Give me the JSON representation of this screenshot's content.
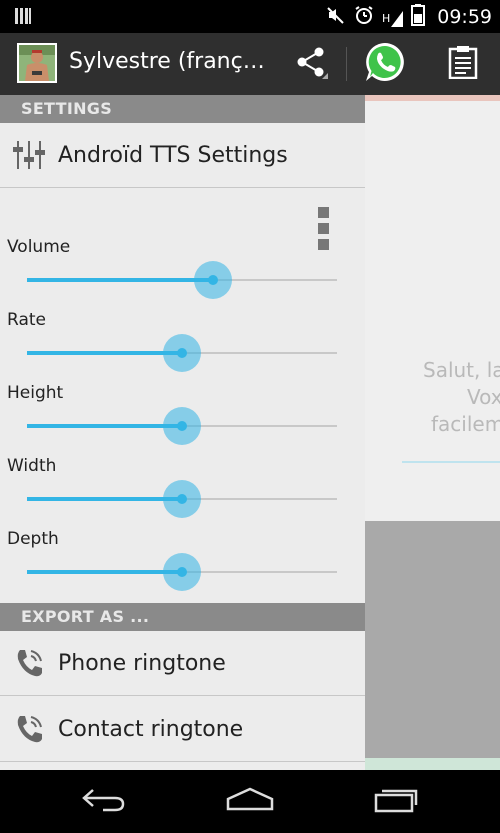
{
  "status_bar": {
    "time": "09:59",
    "network_type": "H",
    "icons": [
      "notification-bars-icon",
      "mute-icon",
      "alarm-icon",
      "signal-icon",
      "battery-icon"
    ]
  },
  "action_bar": {
    "title": "Sylvestre (franç…",
    "actions": [
      "share-icon",
      "whatsapp-icon",
      "clipboard-icon"
    ]
  },
  "drawer": {
    "settings_header": "SETTINGS",
    "tts_settings_label": "Androïd TTS Settings",
    "sliders": [
      {
        "label": "Volume",
        "value": 0.6
      },
      {
        "label": "Rate",
        "value": 0.5
      },
      {
        "label": "Height",
        "value": 0.5
      },
      {
        "label": "Width",
        "value": 0.5
      },
      {
        "label": "Depth",
        "value": 0.5
      }
    ],
    "export_header": "EXPORT AS ...",
    "export_items": [
      {
        "label": "Phone ringtone"
      },
      {
        "label": "Contact ringtone"
      }
    ]
  },
  "main": {
    "text_lines": [
      "Salut, la",
      "Vox",
      "facilem"
    ]
  },
  "colors": {
    "accent": "#33b5e5",
    "action_bar": "#2f2f2f",
    "section_header": "#8a8a8a",
    "whatsapp_green": "#3fc34a"
  }
}
